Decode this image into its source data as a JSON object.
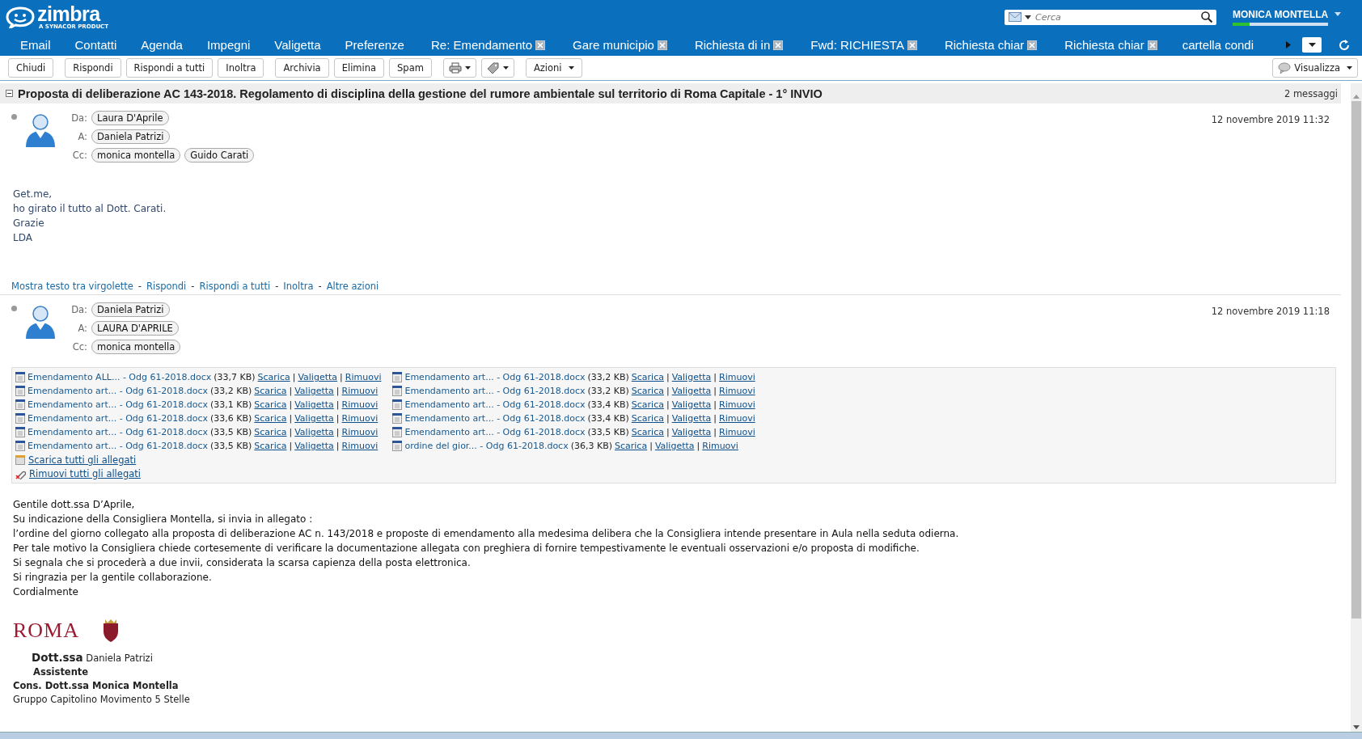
{
  "header": {
    "logo": "zimbra",
    "logo_tagline": "A SYNACOR PRODUCT",
    "search": {
      "placeholder": "Cerca"
    },
    "user": "MONICA MONTELLA"
  },
  "tabs": [
    {
      "label": "Email",
      "closable": false,
      "selected": false
    },
    {
      "label": "Contatti",
      "closable": false,
      "selected": false
    },
    {
      "label": "Agenda",
      "closable": false,
      "selected": false
    },
    {
      "label": "Impegni",
      "closable": false,
      "selected": false
    },
    {
      "label": "Valigetta",
      "closable": false,
      "selected": false
    },
    {
      "label": "Preferenze",
      "closable": false,
      "selected": false
    },
    {
      "label": "Re: Emendamento",
      "closable": true,
      "selected": false
    },
    {
      "label": "Gare municipio",
      "closable": true,
      "selected": false
    },
    {
      "label": "Richiesta di in",
      "closable": true,
      "selected": false
    },
    {
      "label": "Fwd: RICHIESTA",
      "closable": true,
      "selected": false
    },
    {
      "label": "Richiesta chiar",
      "closable": true,
      "selected": false
    },
    {
      "label": "Richiesta chiar",
      "closable": true,
      "selected": false
    },
    {
      "label": "cartella condi",
      "closable": false,
      "selected": false
    }
  ],
  "toolbar": [
    {
      "kind": "text",
      "label": "Chiudi"
    },
    {
      "kind": "text",
      "label": "Rispondi"
    },
    {
      "kind": "text",
      "label": "Rispondi a tutti"
    },
    {
      "kind": "text",
      "label": "Inoltra"
    },
    {
      "kind": "text",
      "label": "Archivia"
    },
    {
      "kind": "text",
      "label": "Elimina"
    },
    {
      "kind": "text",
      "label": "Spam"
    },
    {
      "kind": "print"
    },
    {
      "kind": "tag"
    },
    {
      "kind": "menu",
      "label": "Azioni"
    }
  ],
  "view_button": "Visualizza",
  "conversation": {
    "subject": "Proposta di deliberazione AC 143-2018. Regolamento di disciplina della gestione del rumore ambientale sul territorio di Roma Capitale - 1° INVIO",
    "count": "2 messaggi"
  },
  "messages": [
    {
      "date": "12 novembre 2019 11:32",
      "fields": [
        {
          "label": "Da:",
          "people": [
            "Laura D'Aprile"
          ]
        },
        {
          "label": "A:",
          "people": [
            "Daniela Patrizi"
          ]
        },
        {
          "label": "Cc:",
          "people": [
            "monica montella",
            "Guido Carati"
          ]
        }
      ],
      "body": [
        "Get.me,",
        "ho girato il tutto al Dott. Carati.",
        "Grazie",
        "LDA"
      ],
      "actions": [
        {
          "kind": "link",
          "label": "Mostra testo tra virgolette"
        },
        {
          "kind": "separator",
          "label": "-"
        },
        {
          "kind": "link",
          "label": "Rispondi"
        },
        {
          "kind": "separator",
          "label": "-"
        },
        {
          "kind": "link",
          "label": "Rispondi a tutti"
        },
        {
          "kind": "separator",
          "label": "-"
        },
        {
          "kind": "link",
          "label": "Inoltra"
        },
        {
          "kind": "separator",
          "label": "-"
        },
        {
          "kind": "link",
          "label": "Altre azioni"
        }
      ]
    },
    {
      "date": "12 novembre 2019 11:18",
      "fields": [
        {
          "label": "Da:",
          "people": [
            "Daniela Patrizi"
          ]
        },
        {
          "label": "A:",
          "people": [
            "LAURA D'APRILE"
          ]
        },
        {
          "label": "Cc:",
          "people": [
            "monica montella"
          ]
        }
      ],
      "attachments": [
        {
          "name": "Emendamento ALL... - Odg 61-2018.docx",
          "size": "(33,7 KB)",
          "links": [
            {
              "kind": "link",
              "label": "Scarica"
            },
            {
              "kind": "separator",
              "label": "|"
            },
            {
              "kind": "link",
              "label": "Valigetta"
            },
            {
              "kind": "separator",
              "label": "|"
            },
            {
              "kind": "link",
              "label": "Rimuovi"
            }
          ]
        },
        {
          "name": "Emendamento art... - Odg 61-2018.docx",
          "size": "(33,2 KB)",
          "links": [
            {
              "kind": "link",
              "label": "Scarica"
            },
            {
              "kind": "separator",
              "label": "|"
            },
            {
              "kind": "link",
              "label": "Valigetta"
            },
            {
              "kind": "separator",
              "label": "|"
            },
            {
              "kind": "link",
              "label": "Rimuovi"
            }
          ]
        },
        {
          "name": "Emendamento art... - Odg 61-2018.docx",
          "size": "(33,1 KB)",
          "links": [
            {
              "kind": "link",
              "label": "Scarica"
            },
            {
              "kind": "separator",
              "label": "|"
            },
            {
              "kind": "link",
              "label": "Valigetta"
            },
            {
              "kind": "separator",
              "label": "|"
            },
            {
              "kind": "link",
              "label": "Rimuovi"
            }
          ]
        },
        {
          "name": "Emendamento art... - Odg 61-2018.docx",
          "size": "(33,6 KB)",
          "links": [
            {
              "kind": "link",
              "label": "Scarica"
            },
            {
              "kind": "separator",
              "label": "|"
            },
            {
              "kind": "link",
              "label": "Valigetta"
            },
            {
              "kind": "separator",
              "label": "|"
            },
            {
              "kind": "link",
              "label": "Rimuovi"
            }
          ]
        },
        {
          "name": "Emendamento art... - Odg 61-2018.docx",
          "size": "(33,5 KB)",
          "links": [
            {
              "kind": "link",
              "label": "Scarica"
            },
            {
              "kind": "separator",
              "label": "|"
            },
            {
              "kind": "link",
              "label": "Valigetta"
            },
            {
              "kind": "separator",
              "label": "|"
            },
            {
              "kind": "link",
              "label": "Rimuovi"
            }
          ]
        },
        {
          "name": "Emendamento art... - Odg 61-2018.docx",
          "size": "(33,5 KB)",
          "links": [
            {
              "kind": "link",
              "label": "Scarica"
            },
            {
              "kind": "separator",
              "label": "|"
            },
            {
              "kind": "link",
              "label": "Valigetta"
            },
            {
              "kind": "separator",
              "label": "|"
            },
            {
              "kind": "link",
              "label": "Rimuovi"
            }
          ]
        },
        {
          "name": "Emendamento art... - Odg 61-2018.docx",
          "size": "(33,2 KB)",
          "links": [
            {
              "kind": "link",
              "label": "Scarica"
            },
            {
              "kind": "separator",
              "label": "|"
            },
            {
              "kind": "link",
              "label": "Valigetta"
            },
            {
              "kind": "separator",
              "label": "|"
            },
            {
              "kind": "link",
              "label": "Rimuovi"
            }
          ]
        },
        {
          "name": "Emendamento art... - Odg 61-2018.docx",
          "size": "(33,2 KB)",
          "links": [
            {
              "kind": "link",
              "label": "Scarica"
            },
            {
              "kind": "separator",
              "label": "|"
            },
            {
              "kind": "link",
              "label": "Valigetta"
            },
            {
              "kind": "separator",
              "label": "|"
            },
            {
              "kind": "link",
              "label": "Rimuovi"
            }
          ]
        },
        {
          "name": "Emendamento art... - Odg 61-2018.docx",
          "size": "(33,4 KB)",
          "links": [
            {
              "kind": "link",
              "label": "Scarica"
            },
            {
              "kind": "separator",
              "label": "|"
            },
            {
              "kind": "link",
              "label": "Valigetta"
            },
            {
              "kind": "separator",
              "label": "|"
            },
            {
              "kind": "link",
              "label": "Rimuovi"
            }
          ]
        },
        {
          "name": "Emendamento art... - Odg 61-2018.docx",
          "size": "(33,4 KB)",
          "links": [
            {
              "kind": "link",
              "label": "Scarica"
            },
            {
              "kind": "separator",
              "label": "|"
            },
            {
              "kind": "link",
              "label": "Valigetta"
            },
            {
              "kind": "separator",
              "label": "|"
            },
            {
              "kind": "link",
              "label": "Rimuovi"
            }
          ]
        },
        {
          "name": "Emendamento art... - Odg 61-2018.docx",
          "size": "(33,5 KB)",
          "links": [
            {
              "kind": "link",
              "label": "Scarica"
            },
            {
              "kind": "separator",
              "label": "|"
            },
            {
              "kind": "link",
              "label": "Valigetta"
            },
            {
              "kind": "separator",
              "label": "|"
            },
            {
              "kind": "link",
              "label": "Rimuovi"
            }
          ]
        },
        {
          "name": "ordine del gior... - Odg 61-2018.docx",
          "size": "(36,3 KB)",
          "links": [
            {
              "kind": "link",
              "label": "Scarica"
            },
            {
              "kind": "separator",
              "label": "|"
            },
            {
              "kind": "link",
              "label": "Valigetta"
            },
            {
              "kind": "separator",
              "label": "|"
            },
            {
              "kind": "link",
              "label": "Rimuovi"
            }
          ]
        }
      ],
      "attachment_all": [
        "Scarica tutti gli allegati",
        "Rimuovi tutti gli allegati"
      ],
      "body": [
        "Gentile dott.ssa D’Aprile,",
        "Su indicazione della Consigliera Montella, si invia in allegato :",
        "l’ordine del giorno collegato alla proposta di deliberazione AC n. 143/2018 e proposte di emendamento alla medesima delibera che la Consigliera intende presentare in Aula nella seduta odierna.",
        "Per tale motivo la Consigliera chiede cortesemente di verificare la documentazione allegata con preghiera di fornire tempestivamente le eventuali osservazioni e/o proposta di modifiche.",
        "Si segnala che si procederà a due invii, considerata la scarsa capienza della posta elettronica.",
        "Si ringrazia per la gentile collaborazione.",
        "Cordialmente"
      ],
      "signature": {
        "logo": "ROMA",
        "lines": [
          "**Dott.ssa** Daniela Patrizi",
          "Assistente",
          "Cons. Dott.ssa Monica Montella",
          "Gruppo Capitolino Movimento 5 Stelle"
        ]
      }
    }
  ]
}
